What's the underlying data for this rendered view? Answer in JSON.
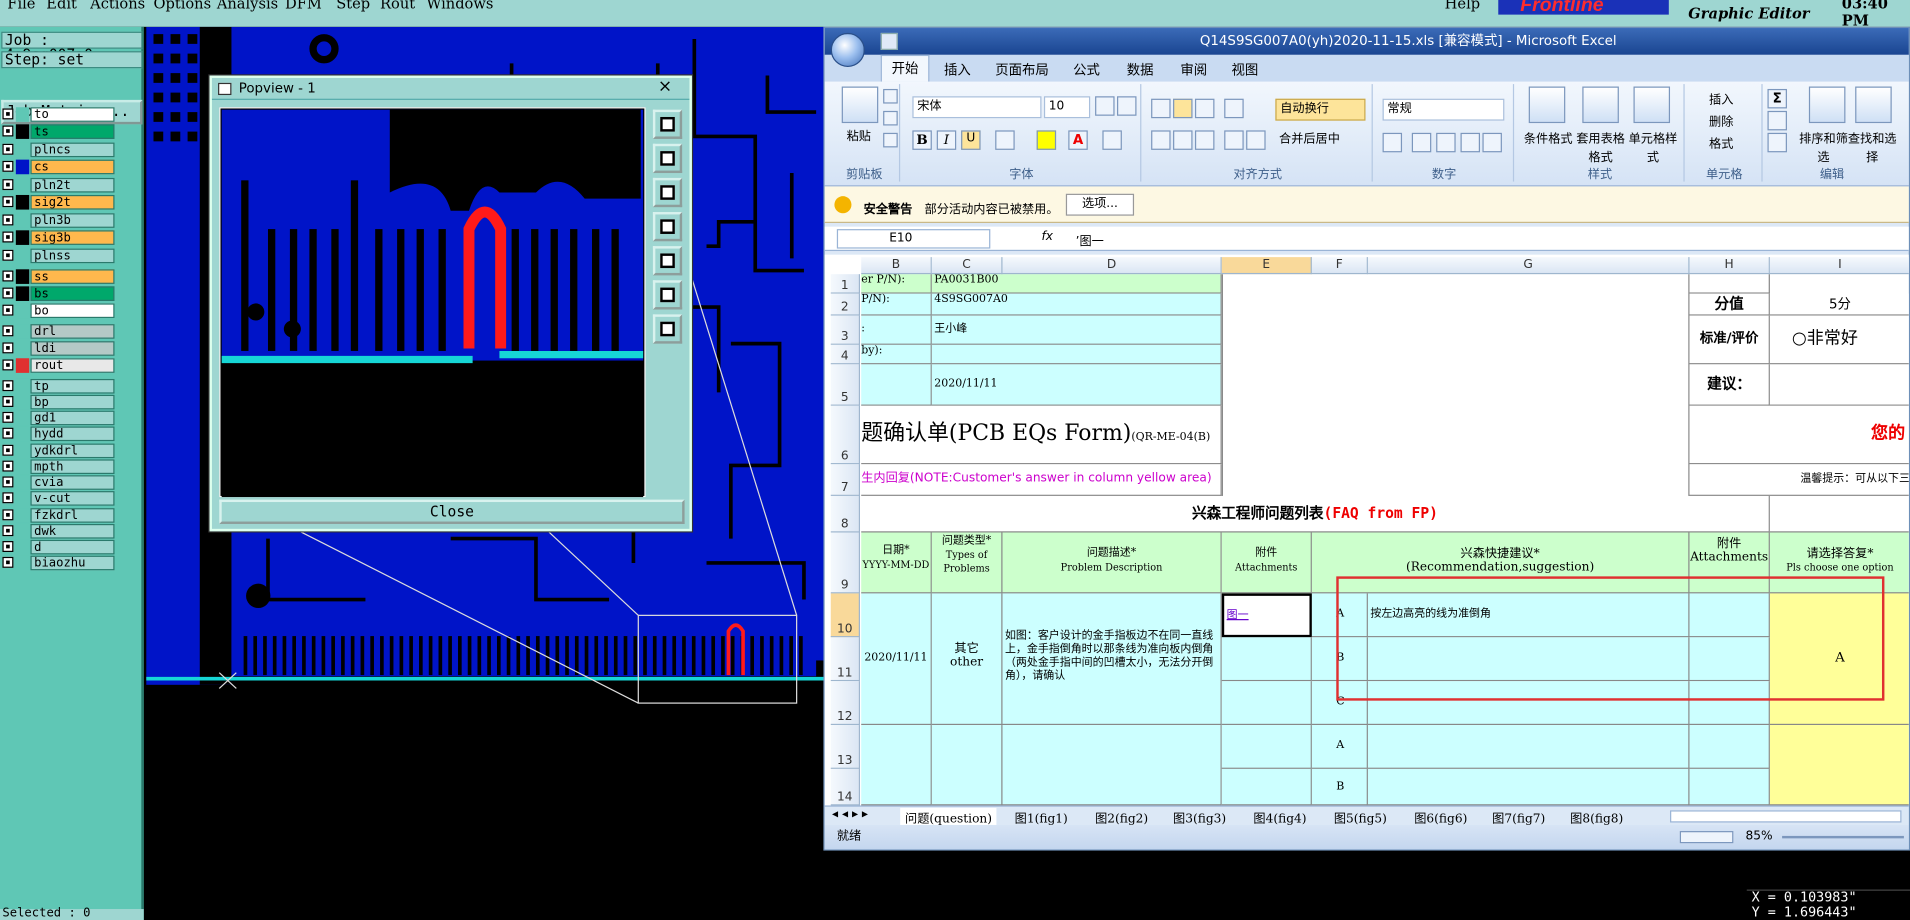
{
  "genesis": {
    "menu": [
      "File",
      "Edit",
      "Actions",
      "Options",
      "Analysis",
      "DFM",
      "Step",
      "Rout",
      "Windows",
      "Help"
    ],
    "brand": "Frontline",
    "brand_sub": "Graphic Editor",
    "time": "03:40 PM",
    "job": "Job : 4s9sg007a0",
    "step": "Step: set",
    "job_matrix": "Job Matrix ...",
    "layers": [
      {
        "name": "to",
        "color": "#ffffff"
      },
      {
        "name": "ts",
        "color": "#00a86b"
      },
      {
        "name": "plncs",
        "color": "#9ed6d1"
      },
      {
        "name": "cs",
        "color": "#ffb84d"
      },
      {
        "name": "pln2t",
        "color": "#9ed6d1"
      },
      {
        "name": "sig2t",
        "color": "#ffb84d"
      },
      {
        "name": "pln3b",
        "color": "#9ed6d1"
      },
      {
        "name": "sig3b",
        "color": "#ffb84d"
      },
      {
        "name": "plnss",
        "color": "#9ed6d1"
      },
      {
        "name": "ss",
        "color": "#ffb84d"
      },
      {
        "name": "bs",
        "color": "#00a86b"
      },
      {
        "name": "bo",
        "color": "#ffffff"
      },
      {
        "name": "drl",
        "color": "#b4c9c6"
      },
      {
        "name": "ldi",
        "color": "#b4c9c6"
      },
      {
        "name": "rout",
        "color": "#e8e8e8"
      },
      {
        "name": "tp",
        "color": "#9ed6d1"
      },
      {
        "name": "bp",
        "color": "#9ed6d1"
      },
      {
        "name": "gd1",
        "color": "#9ed6d1"
      },
      {
        "name": "hydd",
        "color": "#9ed6d1"
      },
      {
        "name": "ydkdrl",
        "color": "#9ed6d1"
      },
      {
        "name": "mpth",
        "color": "#9ed6d1"
      },
      {
        "name": "cvia",
        "color": "#9ed6d1"
      },
      {
        "name": "v-cut",
        "color": "#9ed6d1"
      },
      {
        "name": "fzkdrl",
        "color": "#9ed6d1"
      },
      {
        "name": "dwk",
        "color": "#9ed6d1"
      },
      {
        "name": "d",
        "color": "#9ed6d1"
      },
      {
        "name": "biaozhu",
        "color": "#9ed6d1"
      }
    ],
    "selected": "Selected : 0",
    "coord_x": "X = 0.103983\"",
    "coord_y": "Y = 1.696443\""
  },
  "popview": {
    "title": "Popview - 1",
    "close": "Close",
    "close_x": "×"
  },
  "excel": {
    "title": "Q14S9SG007A0(yh)2020-11-15.xls [兼容模式] - Microsoft Excel",
    "tabs": [
      "开始",
      "插入",
      "页面布局",
      "公式",
      "数据",
      "审阅",
      "视图"
    ],
    "ribbon": {
      "paste": "粘贴",
      "clipboard": "剪贴板",
      "font_name": "宋体",
      "font_size": "10",
      "font_group": "字体",
      "wrap": "自动换行",
      "merge": "合并后居中",
      "align_group": "对齐方式",
      "number_format": "常规",
      "number_group": "数字",
      "cond_format": "条件格式",
      "table_format": "套用表格格式",
      "cell_style": "单元格样式",
      "style_group": "样式",
      "insert": "插入",
      "delete": "删除",
      "format": "格式",
      "cells_group": "单元格",
      "sort": "排序和筛选",
      "find": "查找和选择",
      "edit_group": "编辑"
    },
    "security": {
      "label": "安全警告",
      "msg": "部分活动内容已被禁用。",
      "btn": "选项..."
    },
    "name_box": "E10",
    "formula": "’图一",
    "columns": [
      "B",
      "C",
      "D",
      "E",
      "F",
      "G",
      "H",
      "I"
    ],
    "rows": [
      "1",
      "2",
      "3",
      "4",
      "5",
      "6",
      "7",
      "8",
      "9",
      "10",
      "11",
      "12",
      "13",
      "14"
    ],
    "cells": {
      "b1": "er P/N):",
      "c1": "PA0031B00",
      "b2": "P/N):",
      "c2": "4S9SG007A0",
      "b3": ":",
      "c3": "王小峰",
      "b4": "by):",
      "c5": "2020/11/11",
      "h2": "分值",
      "i2": "5分",
      "h3": "标准/评价",
      "i3": "○非常好",
      "h5": "建议：",
      "title_main": "题确认单",
      "title_en": "(PCB EQs Form)",
      "title_code": "(QR-ME-04(B)",
      "note": "生内回复(NOTE:Customer's answer in column yellow area)",
      "right6": "您的",
      "right7": "温馨提示：可从以下三",
      "faq_cn": "兴森工程师问题列表",
      "faq_en": "(FAQ from FP)",
      "h_date": "日期*",
      "h_date_fmt": "YYYY-MM-DD",
      "h_type": "问题类型*",
      "h_type_en": "Types of Problems",
      "h_desc": "问题描述*",
      "h_desc_en": "Problem Description",
      "h_att": "附件",
      "h_att_en": "Attachments",
      "h_sug": "兴森快捷建议*",
      "h_sug_en": "(Recommendation,suggestion)",
      "h_att2": "附件",
      "h_att2_en": "Attachments",
      "h_choose": "请选择答复*",
      "h_choose_en": "Pls choose one option",
      "r_date": "2020/11/11",
      "r_type": "其它",
      "r_type_en": "other",
      "r_desc": "如图：客户设计的金手指板边不在同一直线上，金手指倒角时以那条线为准向板内倒角（两处金手指中间的凹槽太小，无法分开倒角），请确认",
      "r_att": "图一",
      "opt_a": "A",
      "opt_b": "B",
      "opt_c": "C",
      "sug_a": "按左边高亮的线为准倒角",
      "answer": "A",
      "opt_a2": "A",
      "opt_b2": "B"
    },
    "sheets": [
      "问题(question)",
      "图1(fig1)",
      "图2(fig2)",
      "图3(fig3)",
      "图4(fig4)",
      "图5(fig5)",
      "图6(fig6)",
      "图7(fig7)",
      "图8(fig8)"
    ],
    "status": "就绪",
    "zoom": "85%"
  }
}
